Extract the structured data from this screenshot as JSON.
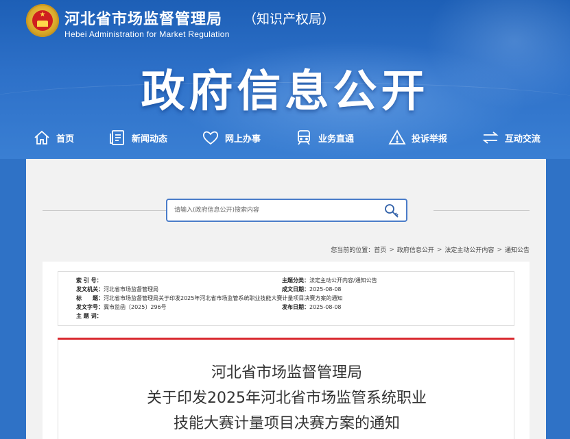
{
  "header": {
    "org_name": "河北省市场监督管理局",
    "org_suffix": "（知识产权局）",
    "org_en": "Hebei Administration for Market Regulation",
    "banner_title": "政府信息公开"
  },
  "nav": [
    {
      "label": "首页",
      "icon": "home-icon"
    },
    {
      "label": "新闻动态",
      "icon": "news-icon"
    },
    {
      "label": "网上办事",
      "icon": "heart-icon"
    },
    {
      "label": "业务直通",
      "icon": "train-icon"
    },
    {
      "label": "投诉举报",
      "icon": "warning-icon"
    },
    {
      "label": "互动交流",
      "icon": "exchange-icon"
    }
  ],
  "search": {
    "placeholder": "请输入(政府信息公开)搜索内容",
    "button_icon": "search-icon"
  },
  "breadcrumb": {
    "prefix": "您当前的位置：",
    "items": [
      "首页",
      "政府信息公开",
      "法定主动公开内容",
      "通知公告"
    ]
  },
  "meta": {
    "index_no_label": "索 引 号：",
    "index_no": "",
    "issuer_label": "发文机关：",
    "issuer": "河北省市场监督管理局",
    "title_label": "标　　题：",
    "title": "河北省市场监督管理局关于印发2025年河北省市场监管系统职业技能大赛计量项目决赛方案的通知",
    "doc_no_label": "发文字号：",
    "doc_no": "冀市监函〔2025〕296号",
    "subject_label": "主 题 词：",
    "subject": "",
    "category_label": "主题分类：",
    "category": "法定主动公开内容/通知公告",
    "created_label": "成文日期：",
    "created": "2025-08-08",
    "published_label": "发布日期：",
    "published": "2025-08-08"
  },
  "document": {
    "title_lines": [
      "河北省市场监督管理局",
      "关于印发2025年河北省市场监管系统职业",
      "技能大赛计量项目决赛方案的通知"
    ]
  },
  "colors": {
    "header_blue": "#2d70c8",
    "accent_red": "#d9292f",
    "search_border": "#4a7cc9"
  }
}
